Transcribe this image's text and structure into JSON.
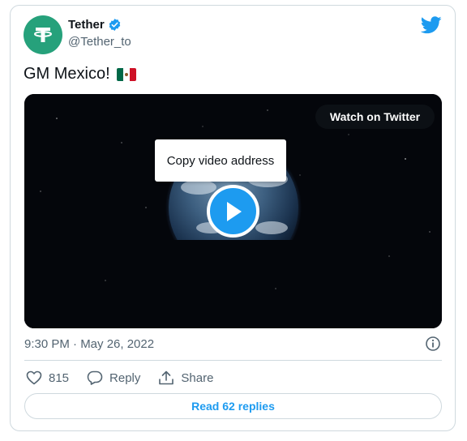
{
  "author": {
    "display_name": "Tether",
    "handle": "@Tether_to",
    "avatar_icon": "tether-logo-icon",
    "verified": true
  },
  "tweet": {
    "text": "GM Mexico!",
    "emoji": "mexico-flag"
  },
  "video": {
    "watch_label": "Watch on Twitter",
    "context_menu_item": "Copy video address"
  },
  "meta": {
    "timestamp": "9:30 PM · May 26, 2022"
  },
  "actions": {
    "like_count": "815",
    "reply_label": "Reply",
    "share_label": "Share"
  },
  "replies_button": "Read 62 replies",
  "colors": {
    "accent": "#1d9bf0",
    "tether_green": "#26a17b",
    "text_secondary": "#536471",
    "border": "#cfd9de"
  }
}
